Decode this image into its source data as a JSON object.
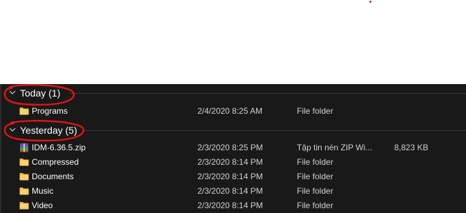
{
  "groups": [
    {
      "title": "Today (1)",
      "items": [
        {
          "name": "Programs",
          "date": "2/4/2020 8:25 AM",
          "type": "File folder",
          "size": "",
          "icon": "folder-icon"
        }
      ]
    },
    {
      "title": "Yesterday (5)",
      "items": [
        {
          "name": "IDM-6.36.5.zip",
          "date": "2/3/2020 8:25 PM",
          "type": "Tập tin nén ZIP Wi...",
          "size": "8,823 KB",
          "icon": "zip-archive-icon"
        },
        {
          "name": "Compressed",
          "date": "2/3/2020 8:14 PM",
          "type": "File folder",
          "size": "",
          "icon": "folder-icon"
        },
        {
          "name": "Documents",
          "date": "2/3/2020 8:14 PM",
          "type": "File folder",
          "size": "",
          "icon": "folder-icon"
        },
        {
          "name": "Music",
          "date": "2/3/2020 8:14 PM",
          "type": "File folder",
          "size": "",
          "icon": "folder-icon"
        },
        {
          "name": "Video",
          "date": "2/3/2020 8:14 PM",
          "type": "File folder",
          "size": "",
          "icon": "folder-icon"
        }
      ]
    }
  ],
  "colors": {
    "background": "#191919",
    "folder": "#f6d36b",
    "annotation": "#e01414"
  }
}
